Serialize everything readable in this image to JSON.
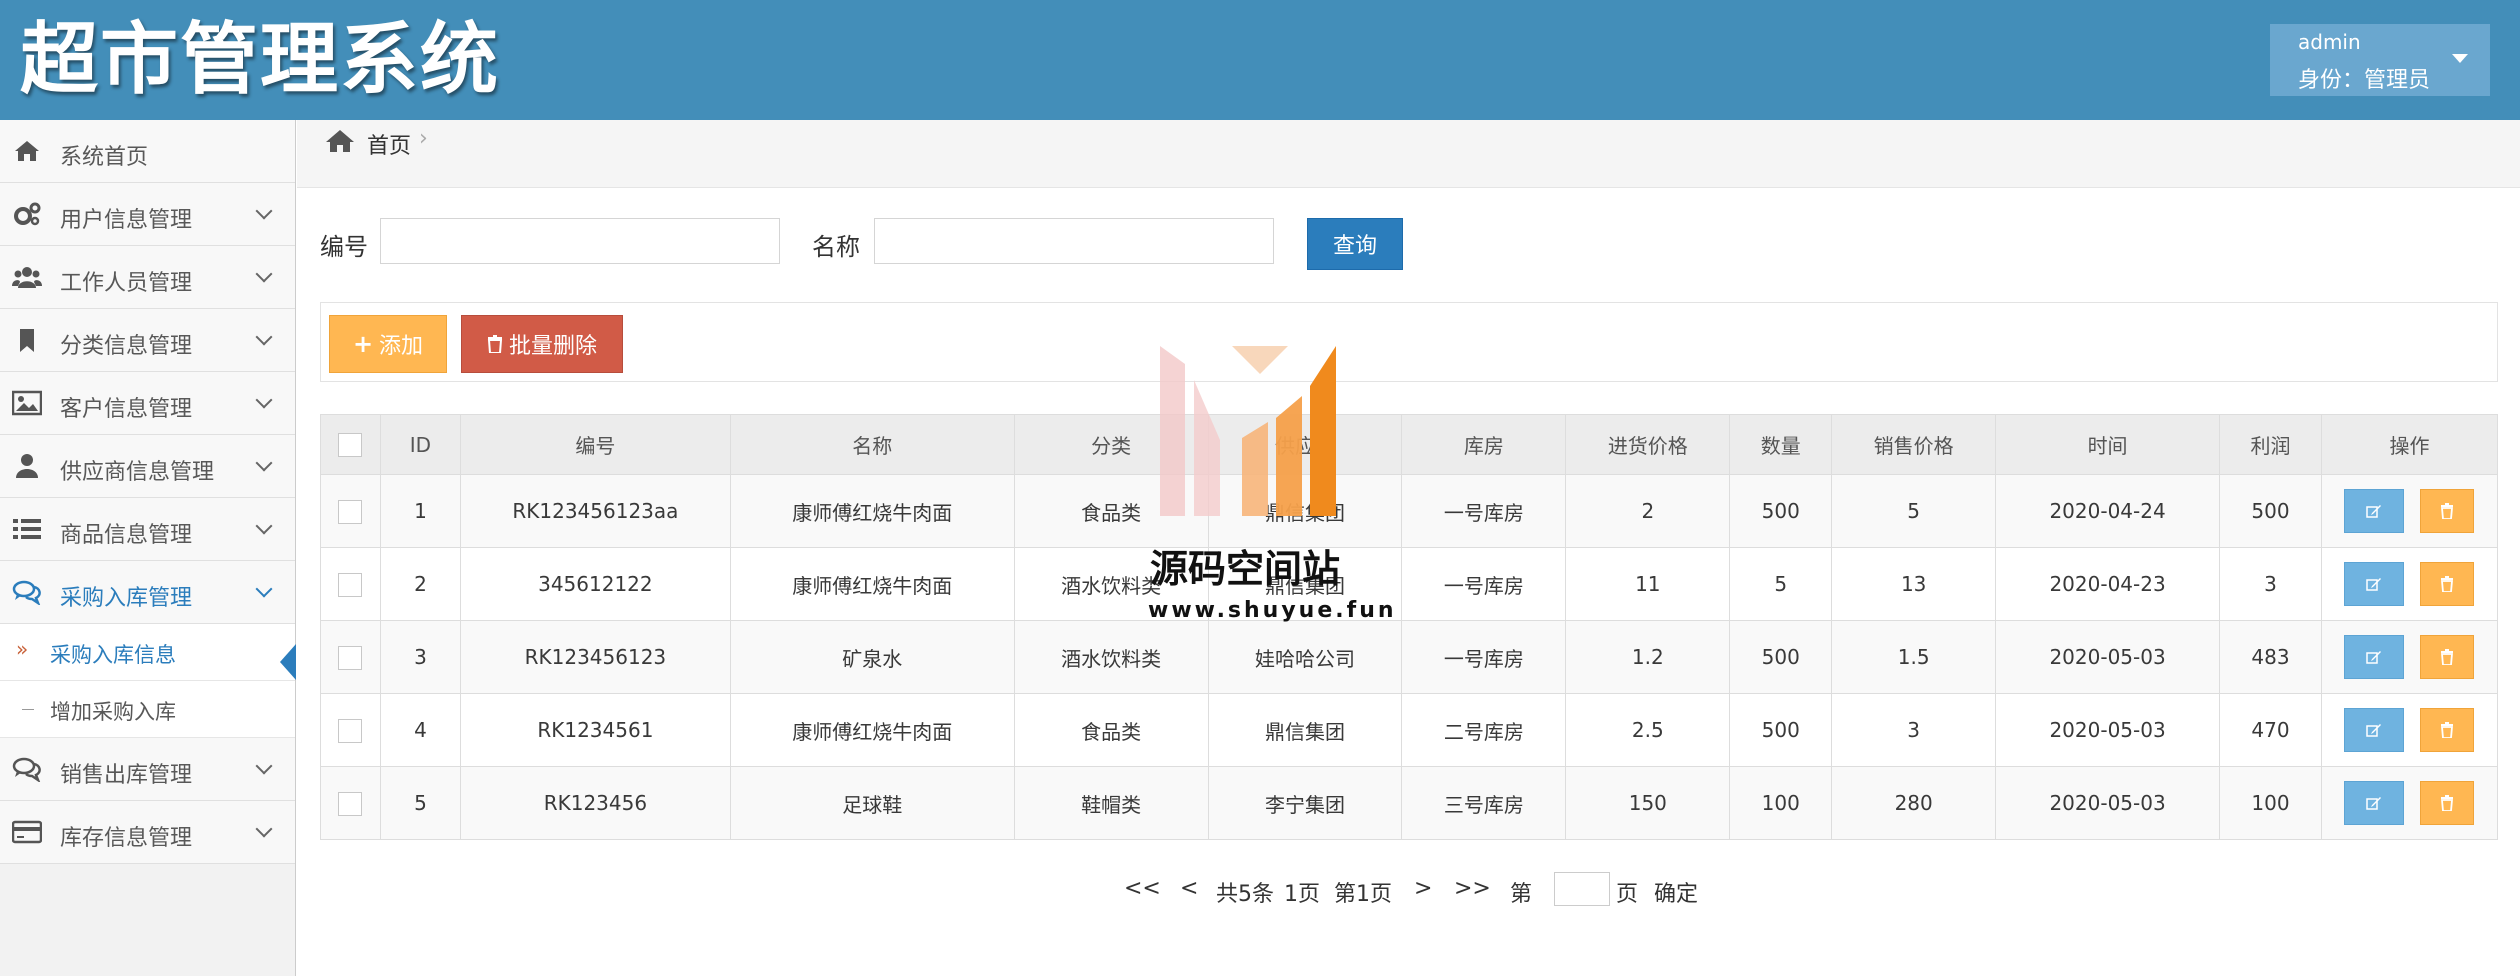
{
  "header": {
    "app_title": "超市管理系统",
    "user_name": "admin",
    "user_role": "身份：管理员"
  },
  "sidebar": {
    "items": [
      {
        "label": "系统首页",
        "icon": "home-icon"
      },
      {
        "label": "用户信息管理",
        "icon": "gears-icon"
      },
      {
        "label": "工作人员管理",
        "icon": "users-icon"
      },
      {
        "label": "分类信息管理",
        "icon": "bookmark-icon"
      },
      {
        "label": "客户信息管理",
        "icon": "picture-icon"
      },
      {
        "label": "供应商信息管理",
        "icon": "user-icon"
      },
      {
        "label": "商品信息管理",
        "icon": "list-icon"
      },
      {
        "label": "采购入库管理",
        "icon": "comments-icon"
      },
      {
        "label": "销售出库管理",
        "icon": "comments-icon"
      },
      {
        "label": "库存信息管理",
        "icon": "credit-card-icon"
      }
    ],
    "sub_items": [
      {
        "label": "采购入库信息",
        "marker": "»"
      },
      {
        "label": "增加采购入库"
      }
    ]
  },
  "breadcrumb": {
    "home": "首页",
    "separator": "›"
  },
  "search": {
    "code_label": "编号",
    "name_label": "名称",
    "code_value": "",
    "name_value": "",
    "query_label": "查询"
  },
  "toolbar": {
    "add_label": "添加",
    "batch_delete_label": "批量删除"
  },
  "table": {
    "columns": [
      "ID",
      "编号",
      "名称",
      "分类",
      "供应商",
      "库房",
      "进货价格",
      "数量",
      "销售价格",
      "时间",
      "利润",
      "操作"
    ],
    "rows": [
      [
        "1",
        "RK123456123aa",
        "康师傅红烧牛肉面",
        "食品类",
        "鼎信集团",
        "一号库房",
        "2",
        "500",
        "5",
        "2020-04-24",
        "500"
      ],
      [
        "2",
        "345612122",
        "康师傅红烧牛肉面",
        "酒水饮料类",
        "鼎信集团",
        "一号库房",
        "11",
        "5",
        "13",
        "2020-04-23",
        "3"
      ],
      [
        "3",
        "RK123456123",
        "矿泉水",
        "酒水饮料类",
        "娃哈哈公司",
        "一号库房",
        "1.2",
        "500",
        "1.5",
        "2020-05-03",
        "483"
      ],
      [
        "4",
        "RK1234561",
        "康师傅红烧牛肉面",
        "食品类",
        "鼎信集团",
        "二号库房",
        "2.5",
        "500",
        "3",
        "2020-05-03",
        "470"
      ],
      [
        "5",
        "RK123456",
        "足球鞋",
        "鞋帽类",
        "李宁集团",
        "三号库房",
        "150",
        "100",
        "280",
        "2020-05-03",
        "100"
      ]
    ]
  },
  "pagination": {
    "first": "<<",
    "prev": "<",
    "total": "共5条",
    "pages": "1页",
    "current": "第1页",
    "next": ">",
    "last": ">>",
    "goto_prefix": "第",
    "goto_suffix": "页",
    "confirm": "确定"
  },
  "watermark": {
    "text": "源码空间站",
    "url": "www.shuyue.fun"
  },
  "colors": {
    "header_bg": "#438eb9",
    "primary": "#2b7dbc",
    "warning": "#ffb752",
    "danger": "#d15b47",
    "info": "#6fb3e0"
  }
}
